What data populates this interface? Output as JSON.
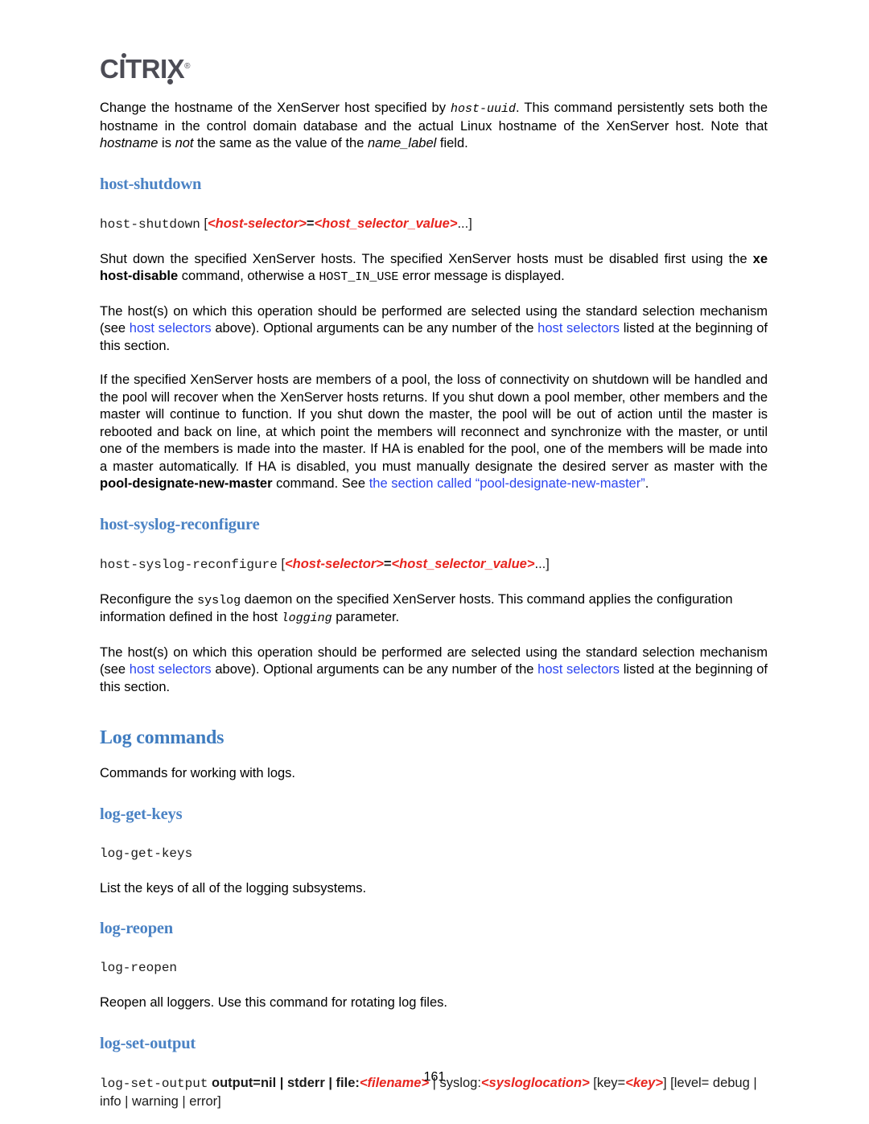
{
  "document": {
    "brand": {
      "logo_text": "CITRIX",
      "logo_registered": "®",
      "logo_color": "#4c4c55"
    },
    "page_number": "161",
    "theme": {
      "heading_blue": "#3f7cc0",
      "command_heading_blue": "#4a82c4",
      "link_blue": "#2b45f0",
      "parameter_red": "#e8251f",
      "text_black": "#000000"
    }
  },
  "intro_paragraph": {
    "part1": "Change the hostname of the XenServer host specified by ",
    "code1": "host-uuid",
    "part2": ". This command persistently sets both the hostname in the control domain database and the actual Linux hostname of the XenServer host. Note that ",
    "em1": "hostname",
    "part3": " is ",
    "em2": "not",
    "part4": " the same as the value of the ",
    "em3": "name_label",
    "part5": " field."
  },
  "sections": {
    "host_shutdown": {
      "heading": "host-shutdown",
      "syntax": {
        "command": "host-shutdown",
        "open_bracket": " [",
        "param1": "<host-selector>",
        "equals": "=",
        "param2": "<host_selector_value>",
        "ellipsis": "...",
        "close_bracket": "]"
      },
      "para1": {
        "part1": "Shut down the specified XenServer hosts. The specified XenServer hosts must be disabled first using the ",
        "bold1": "xe host-disable",
        "part2": " command, otherwise a ",
        "code1": "HOST_IN_USE",
        "part3": " error message is displayed."
      },
      "para2": {
        "part1": "The host(s) on which this operation should be performed are selected using the standard selection mechanism (see ",
        "link1": "host selectors",
        "part2": " above). Optional arguments can be any number of the ",
        "link2": "host selectors",
        "part3": " listed at the beginning of this section."
      },
      "para3": {
        "part1": "If the specified XenServer hosts are members of a pool, the loss of connectivity on shutdown will be handled and the pool will recover when the XenServer hosts returns. If you shut down a pool member, other members and the master will continue to function. If you shut down the master, the pool will be out of action until the master is rebooted and back on line, at which point the members will reconnect and synchronize with the master, or until one of the members is made into the master. If HA is enabled for the pool, one of the members will be made into a master automatically. If HA is disabled, you must manually designate the desired server as master with the ",
        "bold1": "pool-designate-new-master",
        "part2": " command. See ",
        "link1": "the section called “pool-designate-new-master”",
        "part3": "."
      }
    },
    "host_syslog_reconfigure": {
      "heading": "host-syslog-reconfigure",
      "syntax": {
        "command": "host-syslog-reconfigure",
        "open_bracket": " [",
        "param1": "<host-selector>",
        "equals": "=",
        "param2": "<host_selector_value>",
        "ellipsis": "...",
        "close_bracket": "]"
      },
      "para1": {
        "part1": "Reconfigure the ",
        "code1": "syslog",
        "part2": " daemon on the specified XenServer hosts. This command applies the configuration information defined in the host ",
        "code2": "logging",
        "part3": " parameter."
      },
      "para2": {
        "part1": "The host(s) on which this operation should be performed are selected using the standard selection mechanism (see ",
        "link1": "host selectors",
        "part2": " above). Optional arguments can be any number of the ",
        "link2": "host selectors",
        "part3": " listed at the beginning of this section."
      }
    },
    "log_commands": {
      "heading": "Log commands",
      "intro": "Commands for working with logs.",
      "log_get_keys": {
        "heading": "log-get-keys",
        "syntax": "log-get-keys",
        "description": "List the keys of all of the logging subsystems."
      },
      "log_reopen": {
        "heading": "log-reopen",
        "syntax": "log-reopen",
        "description": "Reopen all loggers. Use this command for rotating log files."
      },
      "log_set_output": {
        "heading": "log-set-output",
        "syntax": {
          "command": "log-set-output",
          "opt_bold": " output=nil | stderr | file:",
          "param1": "<filename>",
          "mid1": " | syslog:",
          "param2": "<sysloglocation>",
          "mid2": " [key=",
          "param3": "<key>",
          "mid3": "] [level= debug | info | warning | error]"
        }
      }
    }
  }
}
